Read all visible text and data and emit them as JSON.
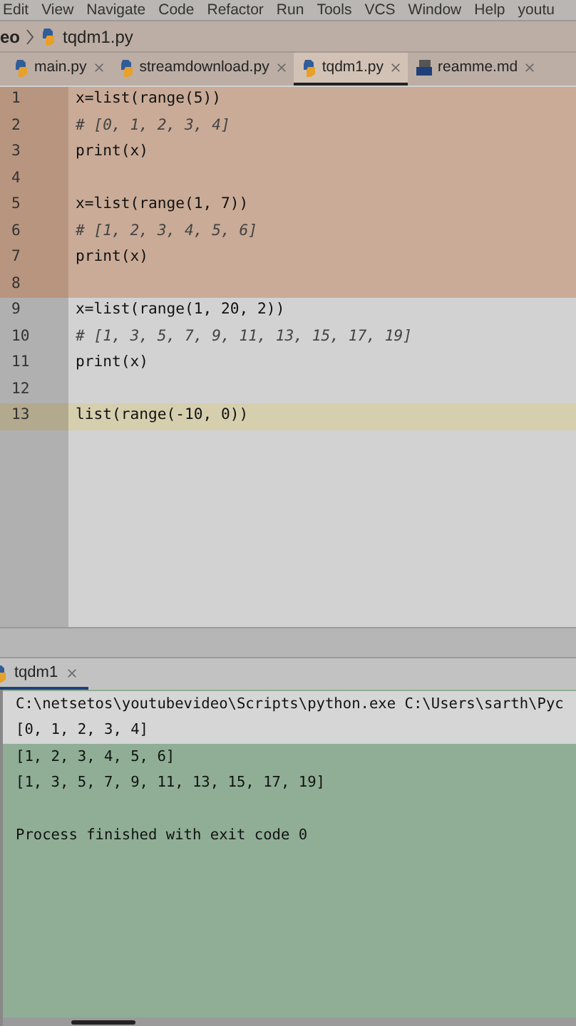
{
  "menu": [
    "Edit",
    "View",
    "Navigate",
    "Code",
    "Refactor",
    "Run",
    "Tools",
    "VCS",
    "Window",
    "Help",
    "youtu"
  ],
  "breadcrumb": {
    "parent": "eo",
    "file": "tqdm1.py"
  },
  "tabs": [
    {
      "label": "main.py",
      "kind": "python",
      "selected": false
    },
    {
      "label": "streamdownload.py",
      "kind": "python",
      "selected": false
    },
    {
      "label": "tqdm1.py",
      "kind": "python",
      "selected": true
    },
    {
      "label": "reamme.md",
      "kind": "markdown",
      "selected": false
    }
  ],
  "editor": {
    "lines": [
      {
        "number": "1",
        "code": "x=list(range(5))",
        "kind": "code",
        "highlighted": true,
        "current": false
      },
      {
        "number": "2",
        "code": "# [0, 1, 2, 3, 4]",
        "kind": "comment",
        "highlighted": true,
        "current": false
      },
      {
        "number": "3",
        "code": "print(x)",
        "kind": "code",
        "highlighted": true,
        "current": false
      },
      {
        "number": "4",
        "highlighted": true,
        "current": false
      },
      {
        "number": "5",
        "code": "x=list(range(1, 7))",
        "kind": "code",
        "highlighted": true,
        "current": false
      },
      {
        "number": "6",
        "code": "# [1, 2, 3, 4, 5, 6]",
        "kind": "comment",
        "highlighted": true,
        "current": false
      },
      {
        "number": "7",
        "code": "print(x)",
        "kind": "code",
        "highlighted": true,
        "current": false
      },
      {
        "number": "8",
        "highlighted": true,
        "current": false
      },
      {
        "number": "9",
        "code": "x=list(range(1, 20, 2))",
        "kind": "code",
        "highlighted": false,
        "current": false
      },
      {
        "number": "10",
        "code": "# [1, 3, 5, 7, 9, 11, 13, 15, 17, 19]",
        "kind": "comment",
        "highlighted": false,
        "current": false
      },
      {
        "number": "11",
        "code": "print(x)",
        "kind": "code",
        "highlighted": false,
        "current": false
      },
      {
        "number": "12",
        "highlighted": false,
        "current": false
      },
      {
        "number": "13",
        "code": "list(range(-10, 0))",
        "kind": "code",
        "highlighted": false,
        "current": true
      }
    ]
  },
  "run_panel": {
    "tab": "tqdm1",
    "lines": [
      {
        "text": "C:\\netsetos\\youtubevideo\\Scripts\\python.exe C:\\Users\\sarth\\Pyc",
        "highlighted": false
      },
      {
        "text": "[0, 1, 2, 3, 4]",
        "highlighted": false
      },
      {
        "text": "[1, 2, 3, 4, 5, 6]",
        "highlighted": true
      },
      {
        "text": "[1, 3, 5, 7, 9, 11, 13, 15, 17, 19]",
        "highlighted": true
      },
      {
        "highlighted": true
      },
      {
        "text": "Process finished with exit code 0",
        "highlighted": true
      }
    ]
  }
}
